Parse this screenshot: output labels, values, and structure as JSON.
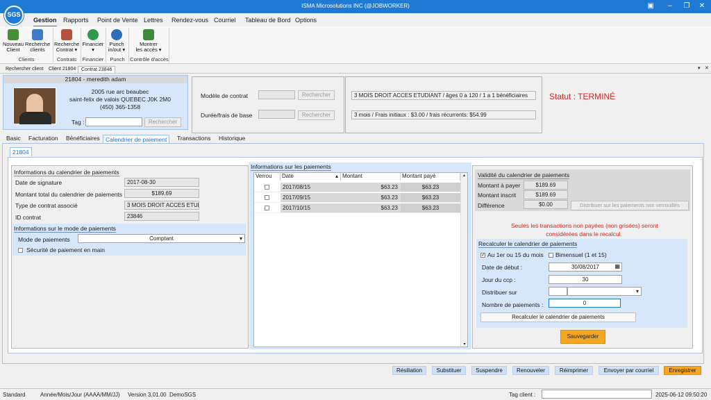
{
  "window": {
    "title": "ISMA Microsolutions INC (@JOBWORKER)",
    "logo": "SGS"
  },
  "menu_tabs": [
    "Gestion",
    "Rapports",
    "Point de Vente",
    "Lettres",
    "Rendez-vous",
    "Courriel",
    "Tableau de Bord",
    "Options"
  ],
  "ribbon": {
    "buttons": [
      {
        "label1": "Nouveau",
        "label2": "Client",
        "icon": "add-client-icon"
      },
      {
        "label1": "Recherche",
        "label2": "clients",
        "icon": "search-clients-icon"
      },
      {
        "label1": "Recherche",
        "label2": "Contrat ▾",
        "icon": "search-contract-icon"
      },
      {
        "label1": "Financier",
        "label2": "▾",
        "icon": "dollar-icon"
      },
      {
        "label1": "Punch",
        "label2": "in/out ▾",
        "icon": "clock-icon"
      },
      {
        "label1": "Montrer",
        "label2": "les accès ▾",
        "icon": "access-icon"
      }
    ],
    "groups": [
      "Clients",
      "Contrats",
      "Financier",
      "Punch",
      "Contrôle d'accès"
    ]
  },
  "doc_tabs": [
    "Rechercher client",
    "Client 21804",
    "Contrat 23846"
  ],
  "client": {
    "header": "21804 - meredith adam",
    "street": "2005 rue arc beaubec",
    "city": "saint-felix de valois QUEBEC J0K 2M0",
    "phone": "(450) 365-1358",
    "tag_label": "Tag :",
    "tag_value": "",
    "search_btn": "Rechercher"
  },
  "contract": {
    "model_label": "Modèle de contrat",
    "duration_label": "Durée/frais de base",
    "search_btn": "Rechercher",
    "model_value": "3 MOIS DROIT ACCES ETUDIANT / âges 0 a 120 / 1 a 1 bénéficiaires",
    "duration_value": "3 mois / Frais initiaux : $3.00 / frais récurrents: $54.99"
  },
  "status": "Statut : TERMINÉ",
  "page_tabs": [
    "Basic",
    "Facturation",
    "Bénéficiaires",
    "Calendrier de paiement",
    "Transactions",
    "Historique"
  ],
  "sub_tab": "21804",
  "calendar_info": {
    "title": "Informations du calendrier de paiements",
    "rows": [
      {
        "label": "Date de signature",
        "value": "2017-08-30"
      },
      {
        "label": "Montant total du calendrier de paiements",
        "value": "$189.69"
      },
      {
        "label": "Type de contrat associé",
        "value": "3 MOIS DROIT ACCES ETUD"
      },
      {
        "label": "ID contrat",
        "value": "23846"
      }
    ]
  },
  "payment_mode": {
    "title": "Informations sur le mode de paiements",
    "label": "Mode de paiements",
    "value": "Comptant",
    "security_label": "Sécurité de paiement en main"
  },
  "payments": {
    "title": "Informations sur les paiements",
    "columns": [
      "Verrou",
      "Date",
      "Montant",
      "Montant payé"
    ],
    "rows": [
      {
        "date": "2017/08/15",
        "amount": "$63.23",
        "paid": "$63.23"
      },
      {
        "date": "2017/09/15",
        "amount": "$63.23",
        "paid": "$63.23"
      },
      {
        "date": "2017/10/15",
        "amount": "$63.23",
        "paid": "$63.23"
      }
    ]
  },
  "validity": {
    "title": "Validité du calendrier de paiements",
    "rows": [
      {
        "label": "Montant à payer",
        "value": "$189.69"
      },
      {
        "label": "Montant inscrit",
        "value": "$189.69"
      },
      {
        "label": "Différence",
        "value": "$0.00"
      }
    ],
    "distribute_btn": "Distribuer sur les paiements non verrouillés",
    "note1": "Seules les transactions non payées (non grisées) seront",
    "note2": "considérées dans le recalcul."
  },
  "recalc": {
    "title": "Recalculer le calendrier de paiements",
    "opt1": "Au 1er ou 15 du mois",
    "opt2": "Bimensuel (1 et 15)",
    "start_label": "Date de début :",
    "start_value": "30/08/2017",
    "day_label": "Jour du ccp :",
    "day_value": "30",
    "distribute_label": "Distribuer sur",
    "count_label": "Nombre de paiements :",
    "count_value": "0",
    "recalc_btn": "Recalculer le calendrier de paiements",
    "save_btn": "Sauvegarder"
  },
  "actions": [
    "Résiliation",
    "Substituer",
    "Suspendre",
    "Renouveler",
    "Réimprimer",
    "Envoyer par courriel",
    "Enregistrer"
  ],
  "statusbar": {
    "mode": "Standard",
    "date_format": "Année/Mois/Jour (AAAA/MM/JJ)",
    "version": "Version 3.01.00",
    "db": "DemoSGS",
    "tag_label": "Tag client :",
    "datetime": "2025-06-12 09:50:20"
  },
  "colors": {
    "accent": "#1f7ad6",
    "status": "#e02020",
    "save": "#f5a623"
  }
}
